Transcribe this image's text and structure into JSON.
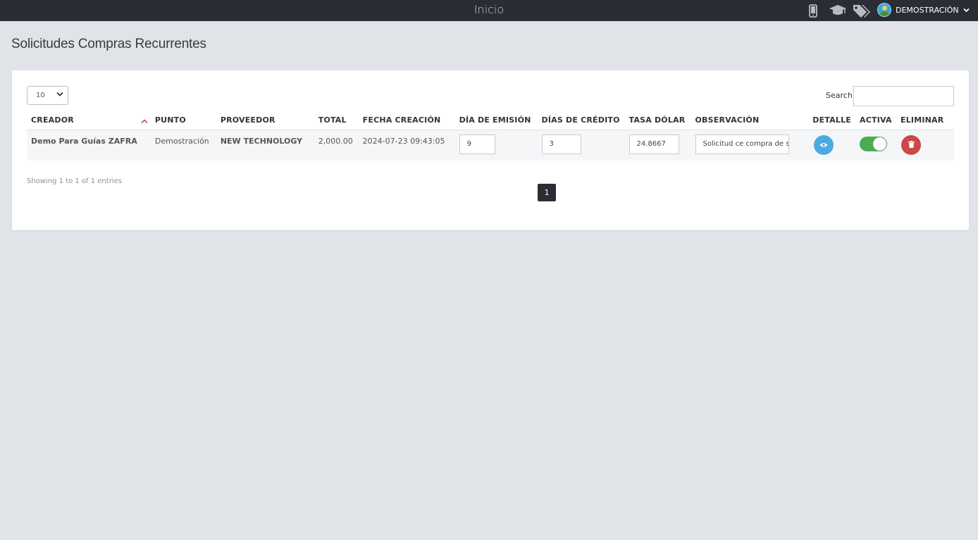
{
  "topbar": {
    "title": "Inicio",
    "icons": [
      "mobile-icon",
      "graduation-cap-icon",
      "tags-icon"
    ],
    "user_label": "DEMOSTRACIÓN"
  },
  "page": {
    "title": "Solicitudes Compras Recurrentes"
  },
  "table_controls": {
    "length_value": "10",
    "search_label": "Search:",
    "search_value": ""
  },
  "table": {
    "columns": [
      "CREADOR",
      "PUNTO",
      "PROVEEDOR",
      "TOTAL",
      "FECHA CREACIÓN",
      "DÍA DE EMISIÓN",
      "DÍAS DE CRÉDITO",
      "TASA DÓLAR",
      "OBSERVACIÓN",
      "DETALLE",
      "ACTIVA",
      "ELIMINAR"
    ],
    "sorted_column": "CREADOR",
    "sort_direction": "ascending",
    "rows": [
      {
        "creador": "Demo Para Guías ZAFRA",
        "punto": "Demostración",
        "proveedor": "NEW TECHNOLOGY",
        "total": "2,000.00",
        "fecha_creacion": "2024-07-23 09:43:05",
        "dia_emision": "9",
        "dias_credito": "3",
        "tasa_dolar": "24.8667",
        "observacion": "Solicitud ce compra de s",
        "activa": true
      }
    ]
  },
  "pagination": {
    "info": "Showing 1 to 1 of 1 entries",
    "current_page": "1"
  },
  "colors": {
    "topbar": "#2a2d33",
    "background": "#e0e4e8",
    "detail_button": "#4ea9e2",
    "delete_button": "#c94a47",
    "toggle_on": "#4aab55",
    "total_link": "#2a44d8",
    "sort_indicator": "#c0392b"
  }
}
